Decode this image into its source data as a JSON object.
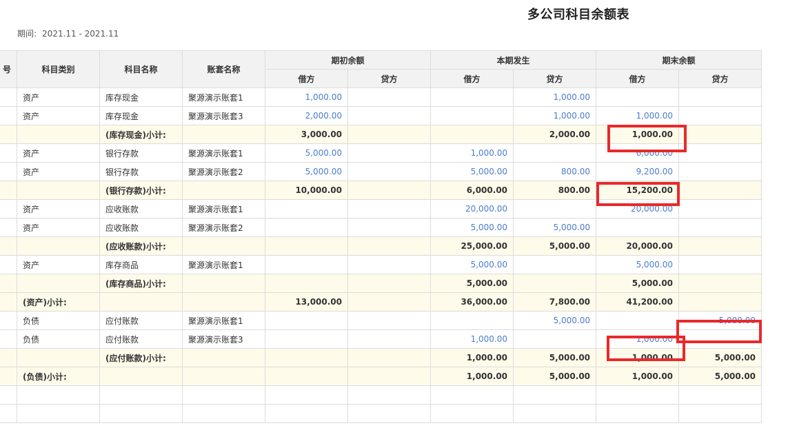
{
  "title": "多公司科目余额表",
  "period": {
    "label": "期间:",
    "value": "2021.11 - 2021.11"
  },
  "headers": {
    "seq_partial": "号",
    "category": "科目类别",
    "account_name": "科目名称",
    "book_name": "账套名称",
    "groups": [
      "期初余额",
      "本期发生",
      "期末余额"
    ],
    "sub": [
      "借方",
      "贷方",
      "借方",
      "贷方",
      "借方",
      "贷方"
    ]
  },
  "rows": [
    {
      "type": "detail",
      "cells": [
        "",
        "资产",
        "库存现金",
        "聚源演示账套1",
        "1,000.00",
        "",
        "",
        "1,000.00",
        "",
        ""
      ]
    },
    {
      "type": "detail",
      "cells": [
        "",
        "资产",
        "库存现金",
        "聚源演示账套3",
        "2,000.00",
        "",
        "",
        "1,000.00",
        "1,000.00",
        ""
      ]
    },
    {
      "type": "subtotal",
      "cells": [
        "",
        "",
        "(库存现金)小计:",
        "",
        "3,000.00",
        "",
        "",
        "2,000.00",
        "1,000.00",
        ""
      ]
    },
    {
      "type": "detail",
      "cells": [
        "",
        "资产",
        "银行存款",
        "聚源演示账套1",
        "5,000.00",
        "",
        "1,000.00",
        "",
        "6,000.00",
        ""
      ]
    },
    {
      "type": "detail",
      "cells": [
        "",
        "资产",
        "银行存款",
        "聚源演示账套2",
        "5,000.00",
        "",
        "5,000.00",
        "800.00",
        "9,200.00",
        ""
      ]
    },
    {
      "type": "subtotal",
      "cells": [
        "",
        "",
        "(银行存款)小计:",
        "",
        "10,000.00",
        "",
        "6,000.00",
        "800.00",
        "15,200.00",
        ""
      ]
    },
    {
      "type": "detail",
      "cells": [
        "",
        "资产",
        "应收账款",
        "聚源演示账套1",
        "",
        "",
        "20,000.00",
        "",
        "20,000.00",
        ""
      ]
    },
    {
      "type": "detail",
      "cells": [
        "",
        "资产",
        "应收账款",
        "聚源演示账套2",
        "",
        "",
        "5,000.00",
        "5,000.00",
        "",
        ""
      ]
    },
    {
      "type": "subtotal",
      "cells": [
        "",
        "",
        "(应收账款)小计:",
        "",
        "",
        "",
        "25,000.00",
        "5,000.00",
        "20,000.00",
        ""
      ]
    },
    {
      "type": "detail",
      "cells": [
        "",
        "资产",
        "库存商品",
        "聚源演示账套1",
        "",
        "",
        "5,000.00",
        "",
        "5,000.00",
        ""
      ]
    },
    {
      "type": "subtotal",
      "cells": [
        "",
        "",
        "(库存商品)小计:",
        "",
        "",
        "",
        "5,000.00",
        "",
        "5,000.00",
        ""
      ]
    },
    {
      "type": "subtotal",
      "cells": [
        "",
        "(资产)小计:",
        "",
        "",
        "13,000.00",
        "",
        "36,000.00",
        "7,800.00",
        "41,200.00",
        ""
      ]
    },
    {
      "type": "detail",
      "cells": [
        "",
        "负债",
        "应付账款",
        "聚源演示账套1",
        "",
        "",
        "",
        "5,000.00",
        "",
        "5,000.00"
      ]
    },
    {
      "type": "detail",
      "cells": [
        "",
        "负债",
        "应付账款",
        "聚源演示账套3",
        "",
        "",
        "1,000.00",
        "",
        "1,000.00",
        ""
      ]
    },
    {
      "type": "subtotal",
      "cells": [
        "",
        "",
        "(应付账款)小计:",
        "",
        "",
        "",
        "1,000.00",
        "5,000.00",
        "1,000.00",
        "5,000.00"
      ]
    },
    {
      "type": "subtotal",
      "cells": [
        "",
        "(负债)小计:",
        "",
        "",
        "",
        "",
        "1,000.00",
        "5,000.00",
        "1,000.00",
        "5,000.00"
      ]
    },
    {
      "type": "blank",
      "cells": [
        "",
        "",
        "",
        "",
        "",
        "",
        "",
        "",
        "",
        ""
      ]
    },
    {
      "type": "blank",
      "cells": [
        "",
        "",
        "",
        "",
        "",
        "",
        "",
        "",
        "",
        ""
      ]
    }
  ]
}
